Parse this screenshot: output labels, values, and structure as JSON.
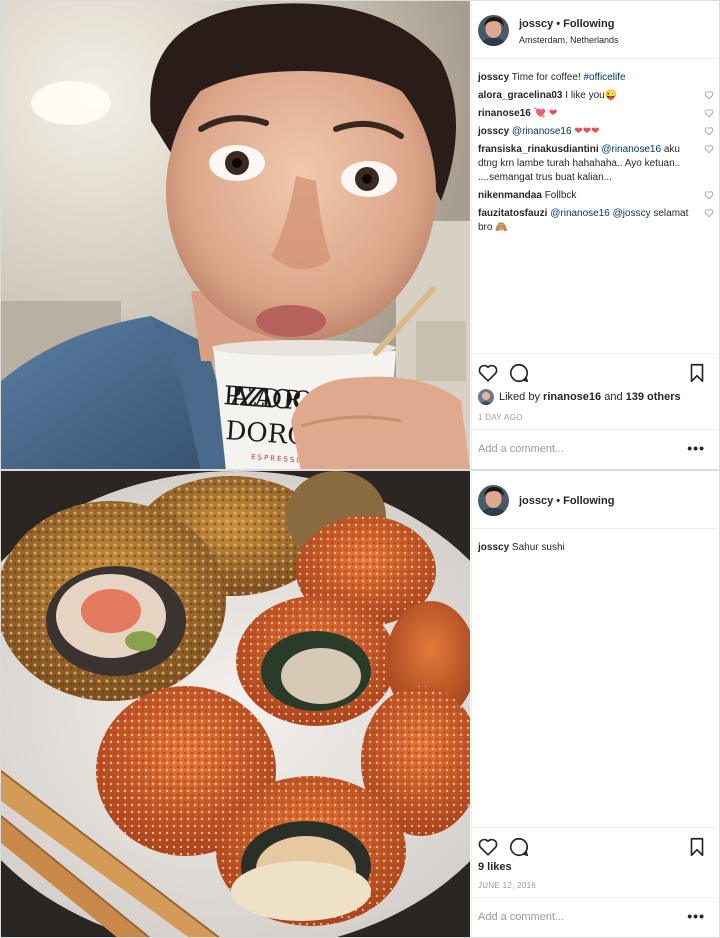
{
  "posts": [
    {
      "username": "josscy",
      "follow_status": "Following",
      "location": "Amsterdam, Netherlands",
      "photo_description": "selfie with coffee cup",
      "cup_brand": "PIAZZA DORO",
      "cup_sub": "ESPRESSO",
      "comments": [
        {
          "user": "josscy",
          "text": "Time for coffee!",
          "tags": "#officelife",
          "liked": false
        },
        {
          "user": "alora_gracelina03",
          "text": "I like you😜",
          "tags": "",
          "liked": true
        },
        {
          "user": "rinanose16",
          "text": "",
          "emoji": "💘 ❤",
          "tags": "",
          "liked": true
        },
        {
          "user": "josscy",
          "text": "",
          "tags": "@rinanose16",
          "emoji": "❤❤❤",
          "liked": true
        },
        {
          "user": "fransiska_rinakusdiantini",
          "text": "aku dtng krn lambe turah hahahaha.. Ayo ketuan.. ....semangat trus buat kalian...",
          "tags": "@rinanose16",
          "liked": true
        },
        {
          "user": "nikenmandaa",
          "text": "Follbck",
          "tags": "",
          "liked": true
        },
        {
          "user": "fauzitatosfauzi",
          "text": "selamat bro 🙈",
          "tags": "@rinanose16 @josscy",
          "liked": true
        }
      ],
      "likes_prefix": "Liked by",
      "likes_user": "rinanose16",
      "likes_and": "and",
      "likes_others": "139 others",
      "date": "1 DAY AGO",
      "add_comment_placeholder": "Add a comment...",
      "more_label": "•••"
    },
    {
      "username": "josscy",
      "follow_status": "Following",
      "caption_user": "josscy",
      "caption": "Sahur sushi",
      "likes": "9 likes",
      "date": "JUNE 12, 2016",
      "add_comment_placeholder": "Add a comment...",
      "more_label": "•••"
    }
  ],
  "icons": {
    "like": "heart-outline-icon",
    "comment": "comment-bubble-icon",
    "save": "bookmark-icon",
    "more": "more-dots-icon"
  },
  "colors": {
    "text": "#262626",
    "muted": "#999999",
    "link": "#003569",
    "border": "#dbdbdb",
    "heart_red": "#ed4956"
  }
}
